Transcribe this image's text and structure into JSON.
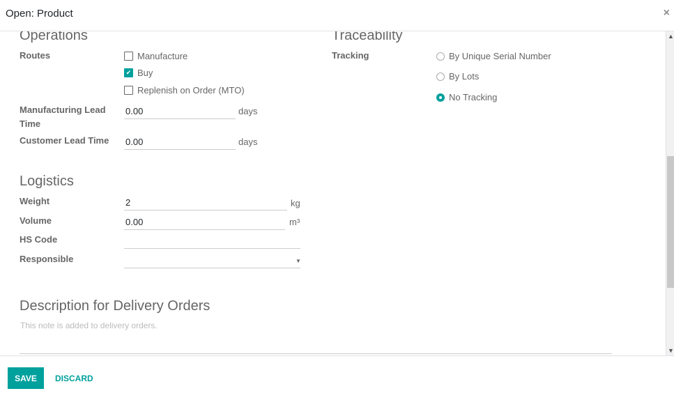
{
  "dialog": {
    "title": "Open: Product",
    "close_icon": "×"
  },
  "operations": {
    "title": "Operations",
    "routes_label": "Routes",
    "routes": [
      {
        "label": "Manufacture",
        "checked": false
      },
      {
        "label": "Buy",
        "checked": true
      },
      {
        "label": "Replenish on Order (MTO)",
        "checked": false
      }
    ],
    "manufacturing_lead_time": {
      "label_line1": "Manufacturing Lead",
      "label_line2": "Time",
      "value": "0.00",
      "unit": "days"
    },
    "customer_lead_time": {
      "label": "Customer Lead Time",
      "value": "0.00",
      "unit": "days"
    }
  },
  "traceability": {
    "title": "Traceability",
    "tracking_label": "Tracking",
    "options": [
      {
        "label": "By Unique Serial Number",
        "selected": false
      },
      {
        "label": "By Lots",
        "selected": false
      },
      {
        "label": "No Tracking",
        "selected": true
      }
    ]
  },
  "logistics": {
    "title": "Logistics",
    "weight": {
      "label": "Weight",
      "value": "2",
      "unit": "kg"
    },
    "volume": {
      "label": "Volume",
      "value": "0.00",
      "unit": "m³"
    },
    "hs_code": {
      "label": "HS Code",
      "value": ""
    },
    "responsible": {
      "label": "Responsible",
      "value": ""
    }
  },
  "description": {
    "title": "Description for Delivery Orders",
    "placeholder": "This note is added to delivery orders."
  },
  "footer": {
    "save_label": "SAVE",
    "discard_label": "DISCARD"
  },
  "colors": {
    "accent": "#00a09d"
  }
}
